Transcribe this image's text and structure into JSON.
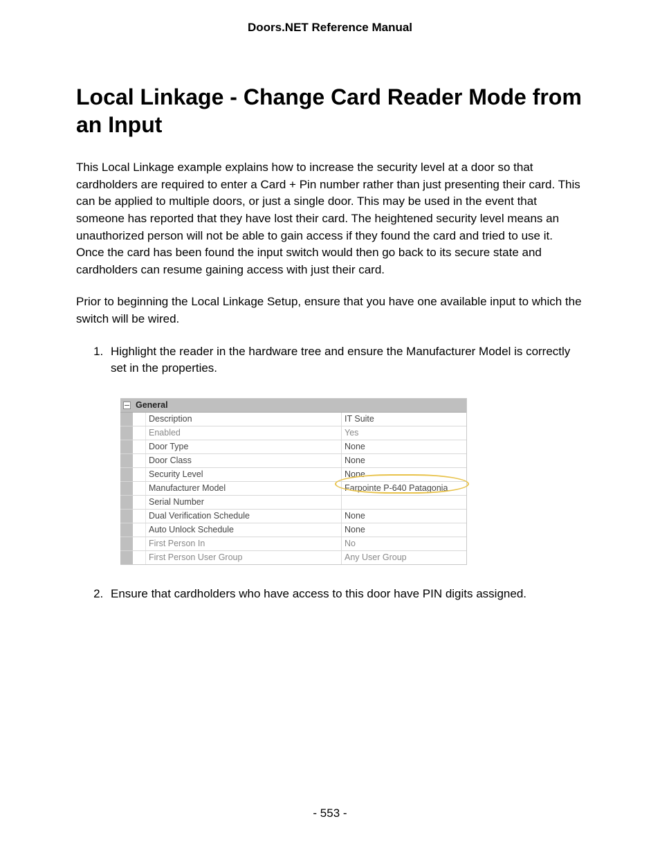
{
  "header": {
    "doc_title": "Doors.NET Reference Manual"
  },
  "title": "Local Linkage - Change Card Reader Mode from an Input",
  "paragraphs": {
    "p1": "This Local Linkage example explains how to increase the security level at a door so that cardholders are required to enter a Card + Pin number rather than just presenting their card. This can be applied to multiple doors, or just a single door. This may be used in the event that someone has reported that they have lost their card. The heightened security level means an unauthorized person will not be able to gain access if they found the card and tried to use it. Once the card has been found the input switch would then go back to its secure state and cardholders can resume gaining access with just their card.",
    "p2": "Prior to beginning the Local Linkage Setup, ensure that you have one available input to which the switch will be wired."
  },
  "steps": {
    "s1": "Highlight the reader in the hardware tree and ensure the Manufacturer Model is correctly set in the properties.",
    "s2": "Ensure that cardholders who have access to this door have PIN digits assigned."
  },
  "property_grid": {
    "group": "General",
    "rows": [
      {
        "label": "Description",
        "value": "IT Suite",
        "dim": false
      },
      {
        "label": "Enabled",
        "value": "Yes",
        "dim": true
      },
      {
        "label": "Door Type",
        "value": "None",
        "dim": false
      },
      {
        "label": "Door Class",
        "value": "None",
        "dim": false
      },
      {
        "label": "Security Level",
        "value": "None",
        "dim": false
      },
      {
        "label": "Manufacturer Model",
        "value": "Farpointe P-640 Patagonia",
        "dim": false,
        "highlight": true
      },
      {
        "label": "Serial Number",
        "value": "",
        "dim": false
      },
      {
        "label": "Dual Verification Schedule",
        "value": "None",
        "dim": false
      },
      {
        "label": "Auto Unlock Schedule",
        "value": "None",
        "dim": false
      },
      {
        "label": "First Person In",
        "value": "No",
        "dim": true
      },
      {
        "label": "First Person User Group",
        "value": "Any User Group",
        "dim": true
      }
    ]
  },
  "footer": {
    "page_number": "- 553 -"
  }
}
